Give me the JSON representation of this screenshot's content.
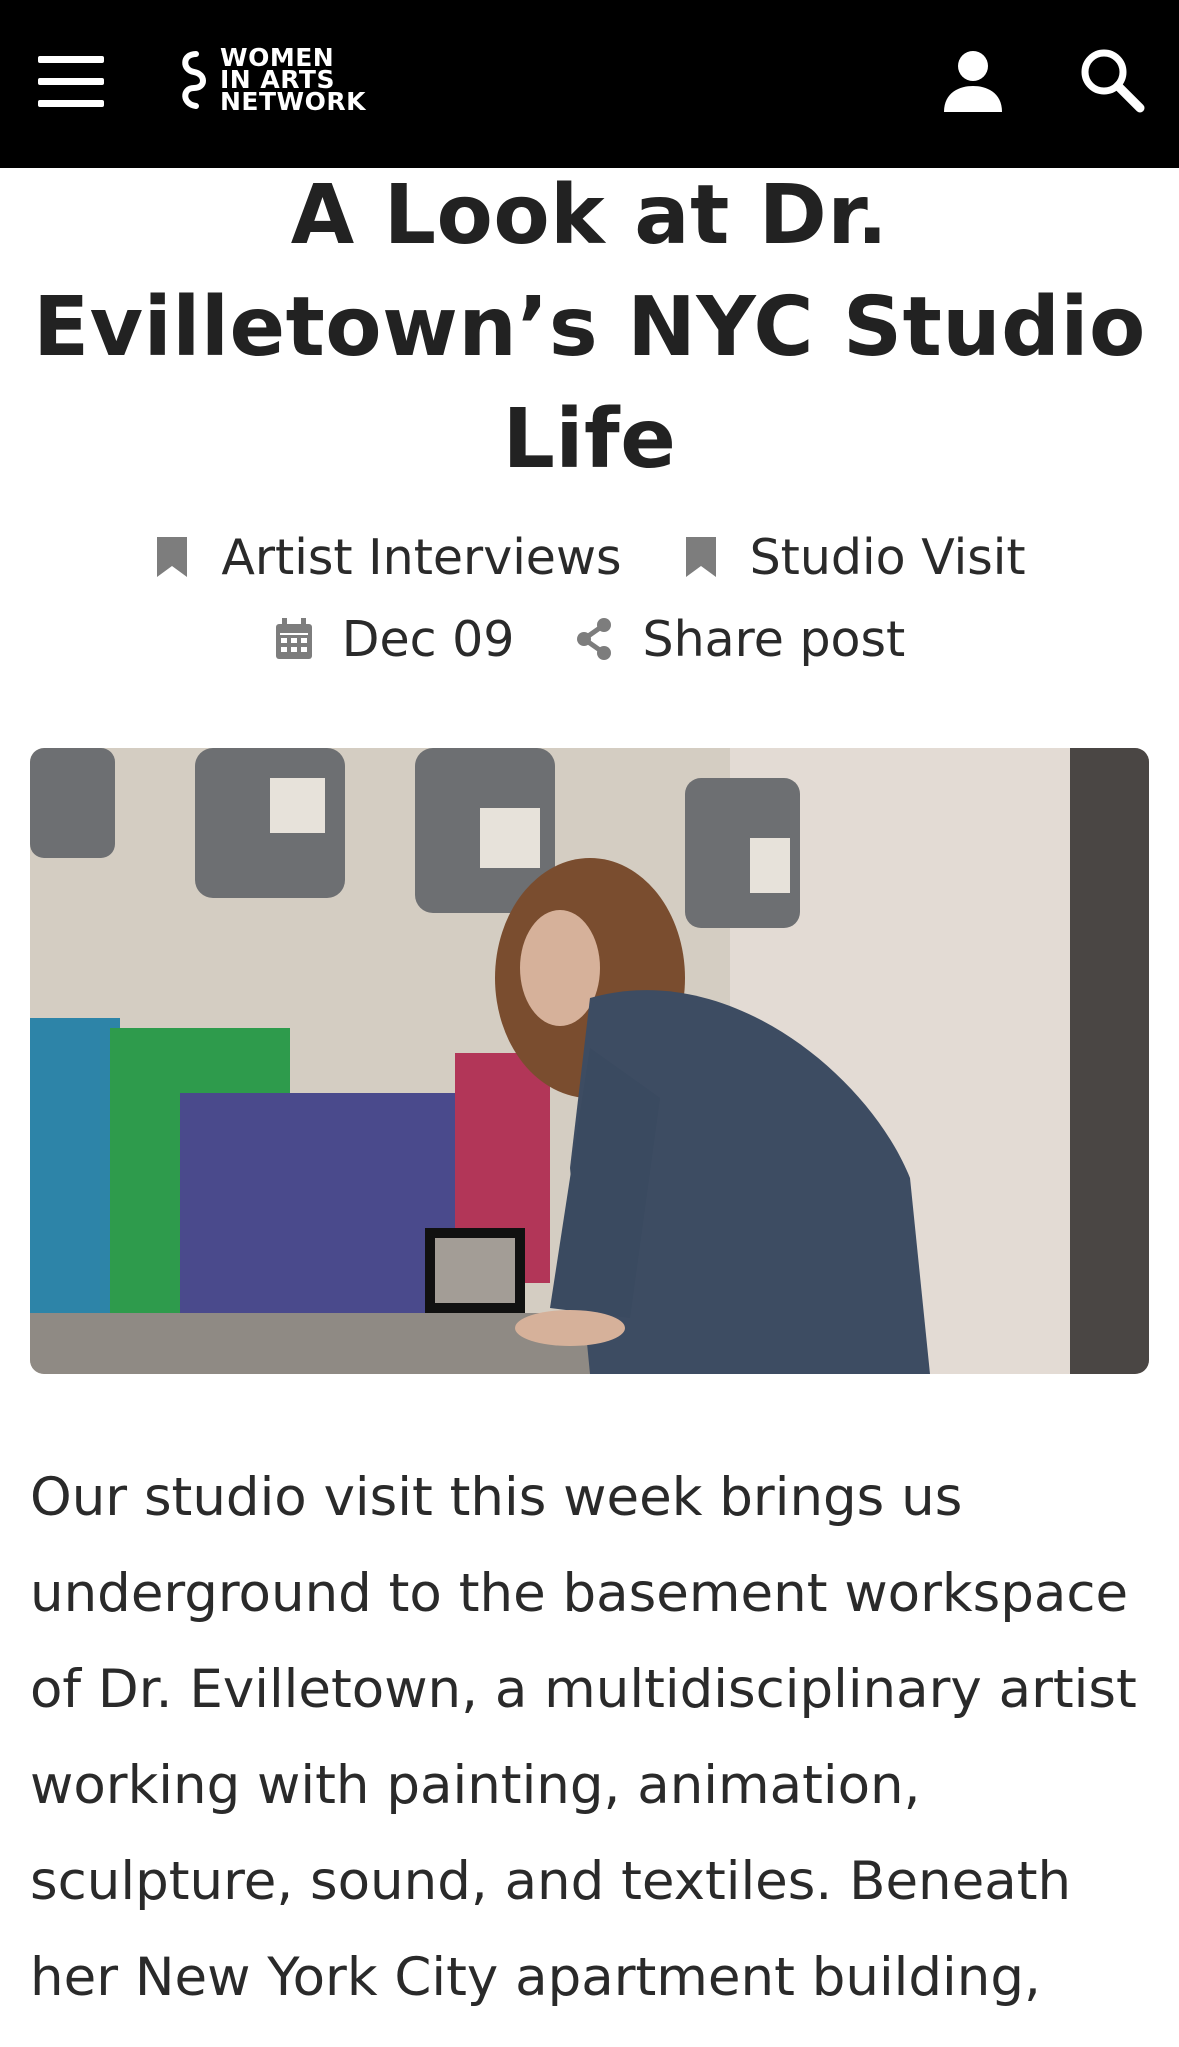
{
  "header": {
    "logo_lines": [
      "WOMEN",
      "IN ARTS",
      "NETWORK"
    ],
    "icons": [
      "menu-icon",
      "logo-mark",
      "user-icon",
      "search-icon"
    ],
    "background": "#000000"
  },
  "article": {
    "title_lines": [
      "A Look at Dr.",
      "Evilletown’s NYC Studio",
      "Life"
    ],
    "categories": [
      "Artist Interviews",
      "Studio Visit"
    ],
    "date": "Dec 09",
    "share_label": "Share post",
    "hero_image": "artist-in-basement-studio-photo",
    "body_lines": [
      "Our studio visit this week brings us",
      "underground to the basement workspace",
      "of Dr. Evilletown, a multidisciplinary artist",
      "working with painting, animation,",
      "sculpture, sound, and textiles. Beneath",
      "her New York City apartment building,"
    ]
  }
}
